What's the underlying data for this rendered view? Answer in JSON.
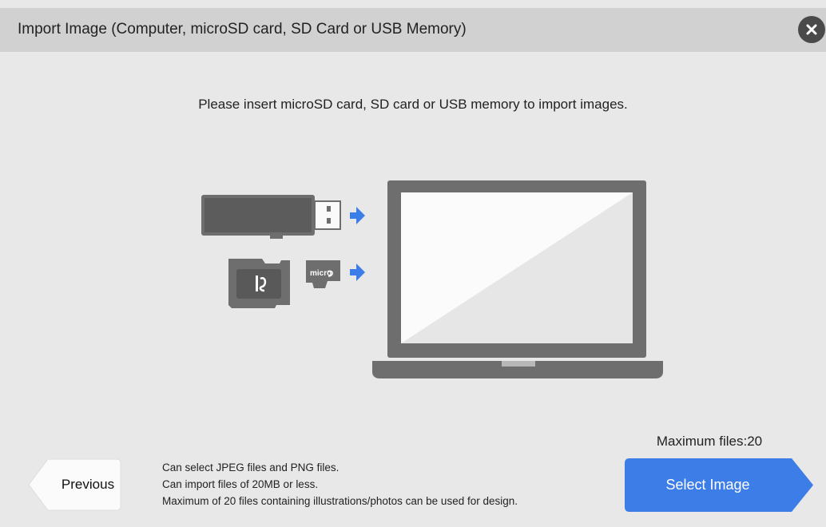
{
  "header": {
    "title": "Import Image (Computer, microSD card, SD Card or USB Memory)",
    "close_icon": "close-icon"
  },
  "main": {
    "instruction": "Please insert microSD card, SD card or USB memory to import images.",
    "illustration": {
      "icons": [
        "usb-memory-icon",
        "sd-card-icon",
        "microsd-card-icon",
        "arrow-right-icon",
        "laptop-icon"
      ],
      "microsd_logo_text": "micro"
    }
  },
  "footer": {
    "notes": [
      "Can select JPEG files and PNG files.",
      "Can import files of 20MB or less.",
      "Maximum of 20 files containing illustrations/photos can be used for design."
    ],
    "max_files": "Maximum files:20",
    "previous_label": "Previous",
    "select_label": "Select Image"
  },
  "colors": {
    "background": "#e8e8e8",
    "header": "#d1d1d1",
    "accent_blue": "#3d7de8",
    "device_gray": "#6e6e6e"
  }
}
